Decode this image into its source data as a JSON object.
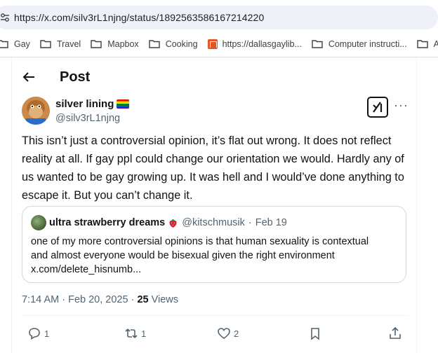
{
  "browser": {
    "url": "https://x.com/silv3rL1njng/status/1892563586167214220",
    "bookmarks": [
      {
        "label": "Gay",
        "icon": "folder-icon"
      },
      {
        "label": "Travel",
        "icon": "folder-icon"
      },
      {
        "label": "Mapbox",
        "icon": "folder-icon"
      },
      {
        "label": "Cooking",
        "icon": "folder-icon"
      },
      {
        "label": "https://dallasgaylib...",
        "icon": "site-favicon-icon"
      },
      {
        "label": "Computer instructi...",
        "icon": "folder-icon"
      },
      {
        "label": "A",
        "icon": "folder-icon"
      }
    ]
  },
  "header": {
    "title": "Post"
  },
  "post": {
    "author_name": "silver lining",
    "author_handle": "@silv3rL1njng",
    "text": "This isn’t just a controversial opinion, it’s flat out wrong. It does not reflect reality at all. If gay ppl could change our orientation we would. Hardly any of us wanted to be gay growing up. It was hell and I would’ve done anything to escape it. But you can’t change it.",
    "quote": {
      "author_name": "ultra strawberry dreams",
      "author_handle": "@kitschmusik",
      "separator": "·",
      "date": "Feb 19",
      "text_line1": "one of my more controversial opinions is that human sexuality is contextual",
      "text_line2": "and almost everyone would be bisexual given the right environment",
      "text_line3": "x.com/delete_hisnumb..."
    },
    "timestamp": "7:14 AM · Feb 20, 2025 ·",
    "views_count": "25",
    "views_label": "Views",
    "stats": {
      "replies": "1",
      "reposts": "1",
      "likes": "2"
    }
  },
  "colors": {
    "text_primary": "#0f1419",
    "text_secondary": "#536471",
    "border": "#cfd9de"
  }
}
